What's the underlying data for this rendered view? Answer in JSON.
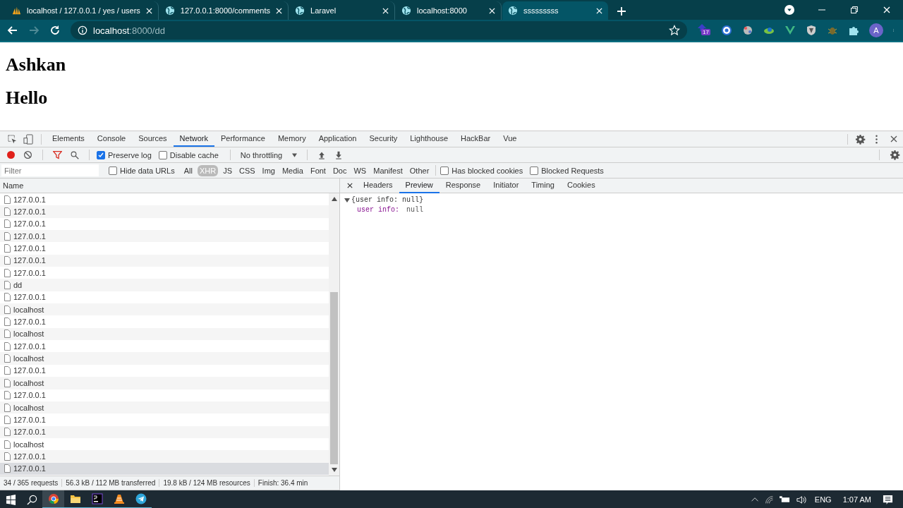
{
  "browser": {
    "tabs": [
      {
        "title": "localhost / 127.0.0.1 / yes / users",
        "selected": false
      },
      {
        "title": "127.0.0.1:8000/comments",
        "selected": false
      },
      {
        "title": "Laravel",
        "selected": false
      },
      {
        "title": "localhost:8000",
        "selected": false
      },
      {
        "title": "sssssssss",
        "selected": true
      }
    ],
    "address": {
      "host": "localhost",
      "path": ":8000/dd"
    },
    "extension_badge": "17",
    "avatar": "A"
  },
  "page": {
    "headings": [
      "Ashkan",
      "Hello"
    ]
  },
  "devtools": {
    "tabs": [
      {
        "label": "Elements",
        "selected": false
      },
      {
        "label": "Console",
        "selected": false
      },
      {
        "label": "Sources",
        "selected": false
      },
      {
        "label": "Network",
        "selected": true
      },
      {
        "label": "Performance",
        "selected": false
      },
      {
        "label": "Memory",
        "selected": false
      },
      {
        "label": "Application",
        "selected": false
      },
      {
        "label": "Security",
        "selected": false
      },
      {
        "label": "Lighthouse",
        "selected": false
      },
      {
        "label": "HackBar",
        "selected": false
      },
      {
        "label": "Vue",
        "selected": false
      }
    ],
    "toolbar": {
      "recording": true,
      "preserve_log": {
        "label": "Preserve log",
        "checked": true
      },
      "disable_cache": {
        "label": "Disable cache",
        "checked": false
      },
      "throttling": "No throttling"
    },
    "filter": {
      "placeholder": "Filter",
      "hide_data_urls": {
        "label": "Hide data URLs",
        "checked": false
      },
      "types": [
        {
          "label": "All",
          "selected": false
        },
        {
          "label": "XHR",
          "selected": true
        },
        {
          "label": "JS",
          "selected": false
        },
        {
          "label": "CSS",
          "selected": false
        },
        {
          "label": "Img",
          "selected": false
        },
        {
          "label": "Media",
          "selected": false
        },
        {
          "label": "Font",
          "selected": false
        },
        {
          "label": "Doc",
          "selected": false
        },
        {
          "label": "WS",
          "selected": false
        },
        {
          "label": "Manifest",
          "selected": false
        },
        {
          "label": "Other",
          "selected": false
        }
      ],
      "has_blocked_cookies": {
        "label": "Has blocked cookies",
        "checked": false
      },
      "blocked_requests": {
        "label": "Blocked Requests",
        "checked": false
      }
    },
    "requests": {
      "column": "Name",
      "rows": [
        {
          "name": "127.0.0.1",
          "selected": false
        },
        {
          "name": "127.0.0.1",
          "selected": false
        },
        {
          "name": "127.0.0.1",
          "selected": false
        },
        {
          "name": "127.0.0.1",
          "selected": false
        },
        {
          "name": "127.0.0.1",
          "selected": false
        },
        {
          "name": "127.0.0.1",
          "selected": false
        },
        {
          "name": "127.0.0.1",
          "selected": false
        },
        {
          "name": "dd",
          "selected": false
        },
        {
          "name": "127.0.0.1",
          "selected": false
        },
        {
          "name": "localhost",
          "selected": false
        },
        {
          "name": "127.0.0.1",
          "selected": false
        },
        {
          "name": "localhost",
          "selected": false
        },
        {
          "name": "127.0.0.1",
          "selected": false
        },
        {
          "name": "localhost",
          "selected": false
        },
        {
          "name": "127.0.0.1",
          "selected": false
        },
        {
          "name": "localhost",
          "selected": false
        },
        {
          "name": "127.0.0.1",
          "selected": false
        },
        {
          "name": "localhost",
          "selected": false
        },
        {
          "name": "127.0.0.1",
          "selected": false
        },
        {
          "name": "127.0.0.1",
          "selected": false
        },
        {
          "name": "localhost",
          "selected": false
        },
        {
          "name": "127.0.0.1",
          "selected": false
        },
        {
          "name": "127.0.0.1",
          "selected": true
        }
      ]
    },
    "detail": {
      "tabs": [
        {
          "label": "Headers",
          "selected": false
        },
        {
          "label": "Preview",
          "selected": true
        },
        {
          "label": "Response",
          "selected": false
        },
        {
          "label": "Initiator",
          "selected": false
        },
        {
          "label": "Timing",
          "selected": false
        },
        {
          "label": "Cookies",
          "selected": false
        }
      ],
      "preview": {
        "summary": "{user info: null}",
        "expanded": true,
        "properties": [
          {
            "key": "user info:",
            "value": "null"
          }
        ]
      }
    },
    "status": [
      "34 / 365 requests",
      "56.3 kB / 112 MB transferred",
      "19.8 kB / 124 MB resources",
      "Finish: 36.4 min"
    ]
  },
  "taskbar": {
    "apps": [
      {
        "active": true
      },
      {
        "active": false
      },
      {
        "active": false
      },
      {
        "active": false
      },
      {
        "active": false
      }
    ],
    "language": "ENG",
    "time": "1:07 AM"
  }
}
